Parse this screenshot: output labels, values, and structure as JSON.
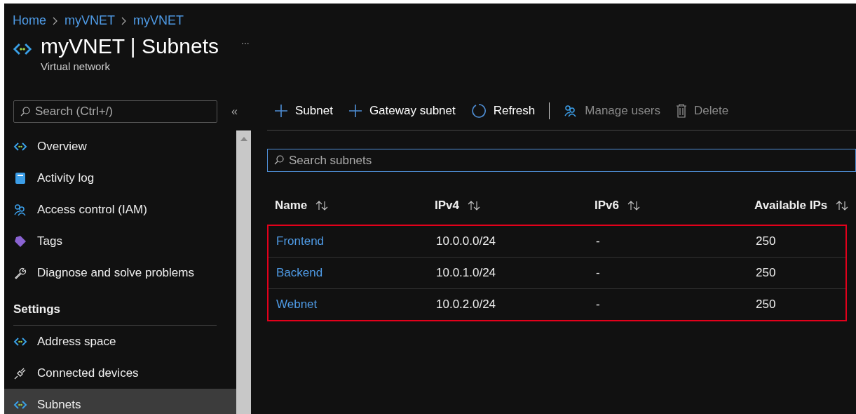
{
  "breadcrumb": [
    "Home",
    "myVNET",
    "myVNET"
  ],
  "header": {
    "title": "myVNET | Subnets",
    "subtitle": "Virtual network",
    "more": "..."
  },
  "sidebar": {
    "search": {
      "placeholder": "Search (Ctrl+/)"
    },
    "collapse": "«",
    "sections": [
      {
        "items": [
          {
            "label": "Overview",
            "selected": false
          },
          {
            "label": "Activity log",
            "selected": false
          },
          {
            "label": "Access control (IAM)",
            "selected": false
          },
          {
            "label": "Tags",
            "selected": false
          },
          {
            "label": "Diagnose and solve problems",
            "selected": false
          }
        ]
      },
      {
        "title": "Settings",
        "items": [
          {
            "label": "Address space",
            "selected": false
          },
          {
            "label": "Connected devices",
            "selected": false
          },
          {
            "label": "Subnets",
            "selected": true
          }
        ]
      }
    ]
  },
  "toolbar": [
    {
      "label": "Subnet",
      "disabled": false
    },
    {
      "label": "Gateway subnet",
      "disabled": false
    },
    {
      "label": "Refresh",
      "disabled": false
    },
    {
      "label": "Manage users",
      "disabled": true
    },
    {
      "label": "Delete",
      "disabled": true
    }
  ],
  "search": {
    "placeholder": "Search subnets"
  },
  "table": {
    "columns": [
      "Name",
      "IPv4",
      "IPv6",
      "Available IPs"
    ],
    "rows_outlined": true,
    "rows": [
      [
        "Frontend",
        "10.0.0.0/24",
        "-",
        "250"
      ],
      [
        "Backend",
        "10.0.1.0/24",
        "-",
        "250"
      ],
      [
        "Webnet",
        "10.0.2.0/24",
        "-",
        "250"
      ]
    ]
  }
}
